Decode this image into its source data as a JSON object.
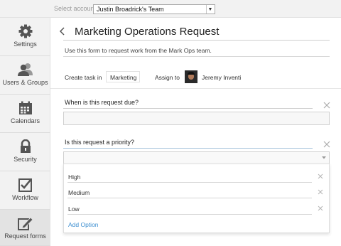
{
  "account": {
    "label": "Select account",
    "selected": "Justin Broadrick's Team"
  },
  "sidebar": {
    "items": [
      {
        "label": "Settings",
        "icon": "gear-icon",
        "active": false
      },
      {
        "label": "Users & Groups",
        "icon": "users-icon",
        "active": false
      },
      {
        "label": "Calendars",
        "icon": "calendar-icon",
        "active": false
      },
      {
        "label": "Security",
        "icon": "lock-icon",
        "active": false
      },
      {
        "label": "Workflow",
        "icon": "checkbox-icon",
        "active": false
      },
      {
        "label": "Request forms",
        "icon": "pencil-edit-icon",
        "active": true
      }
    ]
  },
  "form": {
    "title": "Marketing Operations Request",
    "description": "Use this form to request work from the Mark Ops team.",
    "create_task_label": "Create task in",
    "create_task_value": "Marketing",
    "assign_to_label": "Assign to",
    "assignee": "Jeremy Inventi"
  },
  "questions": [
    {
      "label": "When is this request due?"
    },
    {
      "label": "Is this request a priority?",
      "options": [
        "High",
        "Medium",
        "Low"
      ],
      "add_option": "Add Option"
    }
  ]
}
